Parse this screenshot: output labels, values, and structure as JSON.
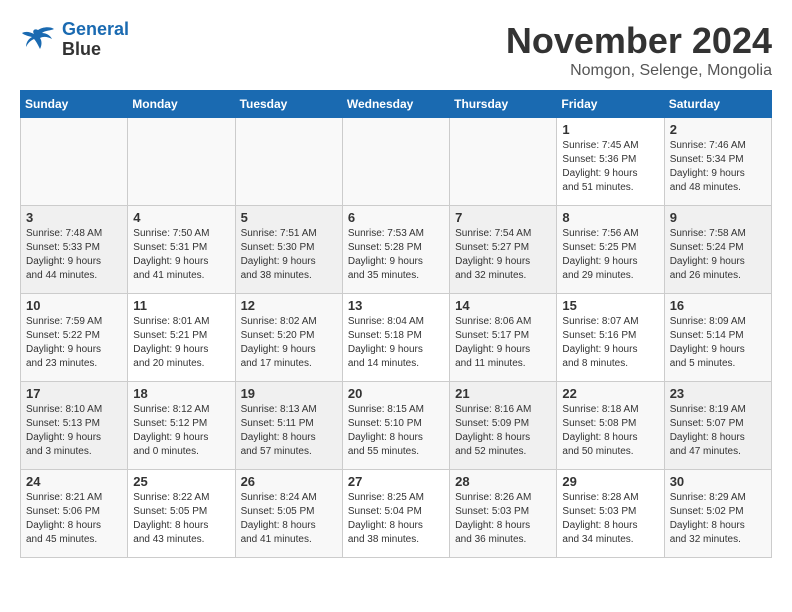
{
  "logo": {
    "line1": "General",
    "line2": "Blue"
  },
  "title": "November 2024",
  "subtitle": "Nomgon, Selenge, Mongolia",
  "days_of_week": [
    "Sunday",
    "Monday",
    "Tuesday",
    "Wednesday",
    "Thursday",
    "Friday",
    "Saturday"
  ],
  "weeks": [
    {
      "days": [
        {
          "num": "",
          "info": ""
        },
        {
          "num": "",
          "info": ""
        },
        {
          "num": "",
          "info": ""
        },
        {
          "num": "",
          "info": ""
        },
        {
          "num": "",
          "info": ""
        },
        {
          "num": "1",
          "info": "Sunrise: 7:45 AM\nSunset: 5:36 PM\nDaylight: 9 hours\nand 51 minutes."
        },
        {
          "num": "2",
          "info": "Sunrise: 7:46 AM\nSunset: 5:34 PM\nDaylight: 9 hours\nand 48 minutes."
        }
      ]
    },
    {
      "days": [
        {
          "num": "3",
          "info": "Sunrise: 7:48 AM\nSunset: 5:33 PM\nDaylight: 9 hours\nand 44 minutes."
        },
        {
          "num": "4",
          "info": "Sunrise: 7:50 AM\nSunset: 5:31 PM\nDaylight: 9 hours\nand 41 minutes."
        },
        {
          "num": "5",
          "info": "Sunrise: 7:51 AM\nSunset: 5:30 PM\nDaylight: 9 hours\nand 38 minutes."
        },
        {
          "num": "6",
          "info": "Sunrise: 7:53 AM\nSunset: 5:28 PM\nDaylight: 9 hours\nand 35 minutes."
        },
        {
          "num": "7",
          "info": "Sunrise: 7:54 AM\nSunset: 5:27 PM\nDaylight: 9 hours\nand 32 minutes."
        },
        {
          "num": "8",
          "info": "Sunrise: 7:56 AM\nSunset: 5:25 PM\nDaylight: 9 hours\nand 29 minutes."
        },
        {
          "num": "9",
          "info": "Sunrise: 7:58 AM\nSunset: 5:24 PM\nDaylight: 9 hours\nand 26 minutes."
        }
      ]
    },
    {
      "days": [
        {
          "num": "10",
          "info": "Sunrise: 7:59 AM\nSunset: 5:22 PM\nDaylight: 9 hours\nand 23 minutes."
        },
        {
          "num": "11",
          "info": "Sunrise: 8:01 AM\nSunset: 5:21 PM\nDaylight: 9 hours\nand 20 minutes."
        },
        {
          "num": "12",
          "info": "Sunrise: 8:02 AM\nSunset: 5:20 PM\nDaylight: 9 hours\nand 17 minutes."
        },
        {
          "num": "13",
          "info": "Sunrise: 8:04 AM\nSunset: 5:18 PM\nDaylight: 9 hours\nand 14 minutes."
        },
        {
          "num": "14",
          "info": "Sunrise: 8:06 AM\nSunset: 5:17 PM\nDaylight: 9 hours\nand 11 minutes."
        },
        {
          "num": "15",
          "info": "Sunrise: 8:07 AM\nSunset: 5:16 PM\nDaylight: 9 hours\nand 8 minutes."
        },
        {
          "num": "16",
          "info": "Sunrise: 8:09 AM\nSunset: 5:14 PM\nDaylight: 9 hours\nand 5 minutes."
        }
      ]
    },
    {
      "days": [
        {
          "num": "17",
          "info": "Sunrise: 8:10 AM\nSunset: 5:13 PM\nDaylight: 9 hours\nand 3 minutes."
        },
        {
          "num": "18",
          "info": "Sunrise: 8:12 AM\nSunset: 5:12 PM\nDaylight: 9 hours\nand 0 minutes."
        },
        {
          "num": "19",
          "info": "Sunrise: 8:13 AM\nSunset: 5:11 PM\nDaylight: 8 hours\nand 57 minutes."
        },
        {
          "num": "20",
          "info": "Sunrise: 8:15 AM\nSunset: 5:10 PM\nDaylight: 8 hours\nand 55 minutes."
        },
        {
          "num": "21",
          "info": "Sunrise: 8:16 AM\nSunset: 5:09 PM\nDaylight: 8 hours\nand 52 minutes."
        },
        {
          "num": "22",
          "info": "Sunrise: 8:18 AM\nSunset: 5:08 PM\nDaylight: 8 hours\nand 50 minutes."
        },
        {
          "num": "23",
          "info": "Sunrise: 8:19 AM\nSunset: 5:07 PM\nDaylight: 8 hours\nand 47 minutes."
        }
      ]
    },
    {
      "days": [
        {
          "num": "24",
          "info": "Sunrise: 8:21 AM\nSunset: 5:06 PM\nDaylight: 8 hours\nand 45 minutes."
        },
        {
          "num": "25",
          "info": "Sunrise: 8:22 AM\nSunset: 5:05 PM\nDaylight: 8 hours\nand 43 minutes."
        },
        {
          "num": "26",
          "info": "Sunrise: 8:24 AM\nSunset: 5:05 PM\nDaylight: 8 hours\nand 41 minutes."
        },
        {
          "num": "27",
          "info": "Sunrise: 8:25 AM\nSunset: 5:04 PM\nDaylight: 8 hours\nand 38 minutes."
        },
        {
          "num": "28",
          "info": "Sunrise: 8:26 AM\nSunset: 5:03 PM\nDaylight: 8 hours\nand 36 minutes."
        },
        {
          "num": "29",
          "info": "Sunrise: 8:28 AM\nSunset: 5:03 PM\nDaylight: 8 hours\nand 34 minutes."
        },
        {
          "num": "30",
          "info": "Sunrise: 8:29 AM\nSunset: 5:02 PM\nDaylight: 8 hours\nand 32 minutes."
        }
      ]
    }
  ]
}
